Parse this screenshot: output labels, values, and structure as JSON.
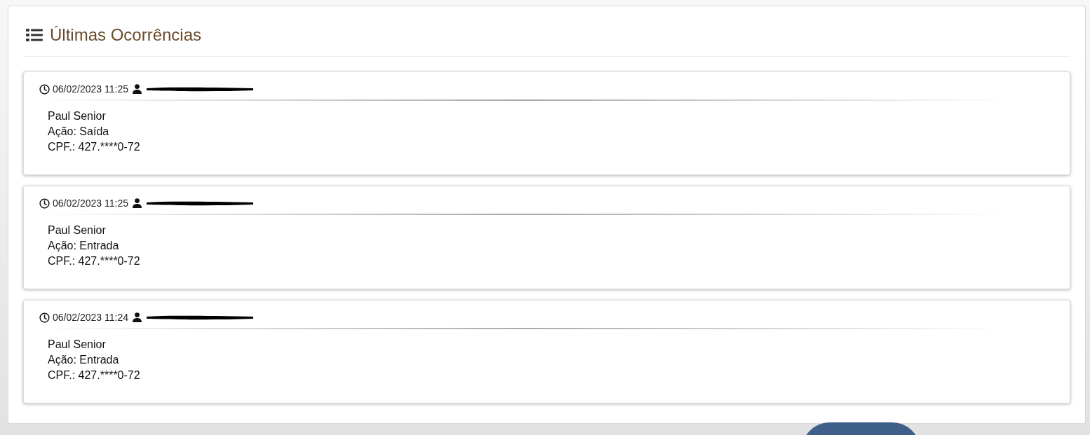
{
  "panel": {
    "title": "Últimas Ocorrências"
  },
  "occurrences": [
    {
      "datetime": "06/02/2023 11:25",
      "user_redacted": true,
      "name": "Paul Senior",
      "action": "Ação: Saída",
      "cpf": "CPF.: 427.****0-72"
    },
    {
      "datetime": "06/02/2023 11:25",
      "user_redacted": true,
      "name": "Paul Senior",
      "action": "Ação: Entrada",
      "cpf": "CPF.: 427.****0-72"
    },
    {
      "datetime": "06/02/2023 11:24",
      "user_redacted": true,
      "name": "Paul Senior",
      "action": "Ação: Entrada",
      "cpf": "CPF.: 427.****0-72"
    }
  ]
}
